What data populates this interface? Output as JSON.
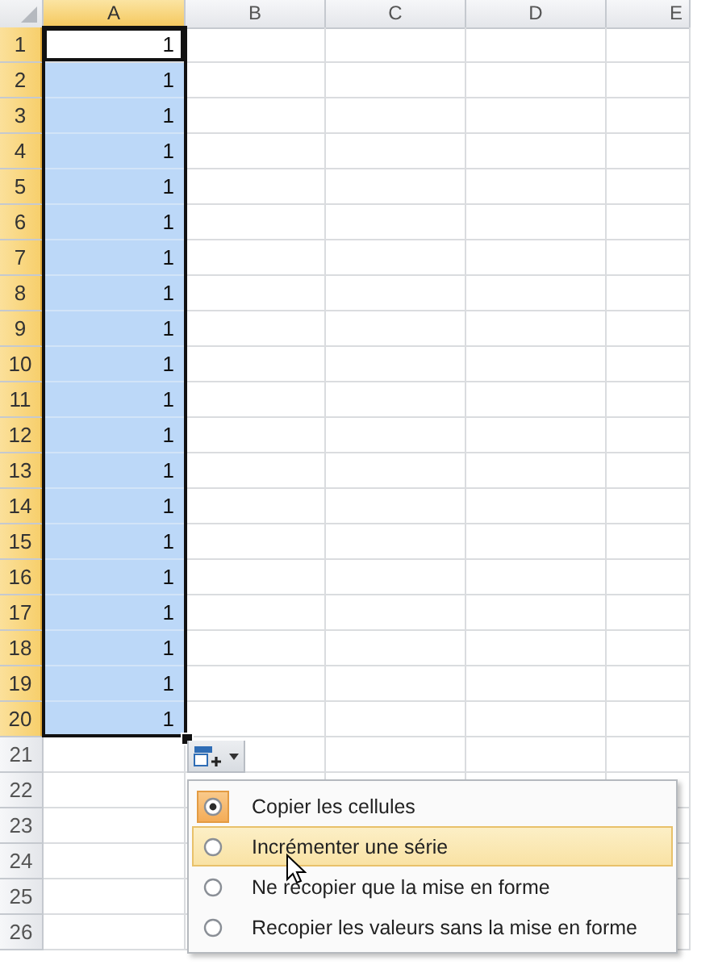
{
  "columns": [
    {
      "label": "A",
      "selected": true
    },
    {
      "label": "B",
      "selected": false
    },
    {
      "label": "C",
      "selected": false
    },
    {
      "label": "D",
      "selected": false
    },
    {
      "label": "E",
      "selected": false
    }
  ],
  "rows": [
    {
      "header": "1",
      "selected": true,
      "active": true,
      "cells": [
        "1"
      ]
    },
    {
      "header": "2",
      "selected": true,
      "active": false,
      "cells": [
        "1"
      ]
    },
    {
      "header": "3",
      "selected": true,
      "active": false,
      "cells": [
        "1"
      ]
    },
    {
      "header": "4",
      "selected": true,
      "active": false,
      "cells": [
        "1"
      ]
    },
    {
      "header": "5",
      "selected": true,
      "active": false,
      "cells": [
        "1"
      ]
    },
    {
      "header": "6",
      "selected": true,
      "active": false,
      "cells": [
        "1"
      ]
    },
    {
      "header": "7",
      "selected": true,
      "active": false,
      "cells": [
        "1"
      ]
    },
    {
      "header": "8",
      "selected": true,
      "active": false,
      "cells": [
        "1"
      ]
    },
    {
      "header": "9",
      "selected": true,
      "active": false,
      "cells": [
        "1"
      ]
    },
    {
      "header": "10",
      "selected": true,
      "active": false,
      "cells": [
        "1"
      ]
    },
    {
      "header": "11",
      "selected": true,
      "active": false,
      "cells": [
        "1"
      ]
    },
    {
      "header": "12",
      "selected": true,
      "active": false,
      "cells": [
        "1"
      ]
    },
    {
      "header": "13",
      "selected": true,
      "active": false,
      "cells": [
        "1"
      ]
    },
    {
      "header": "14",
      "selected": true,
      "active": false,
      "cells": [
        "1"
      ]
    },
    {
      "header": "15",
      "selected": true,
      "active": false,
      "cells": [
        "1"
      ]
    },
    {
      "header": "16",
      "selected": true,
      "active": false,
      "cells": [
        "1"
      ]
    },
    {
      "header": "17",
      "selected": true,
      "active": false,
      "cells": [
        "1"
      ]
    },
    {
      "header": "18",
      "selected": true,
      "active": false,
      "cells": [
        "1"
      ]
    },
    {
      "header": "19",
      "selected": true,
      "active": false,
      "cells": [
        "1"
      ]
    },
    {
      "header": "20",
      "selected": true,
      "active": false,
      "cells": [
        "1"
      ]
    },
    {
      "header": "21",
      "selected": false,
      "active": false,
      "cells": []
    },
    {
      "header": "22",
      "selected": false,
      "active": false,
      "cells": []
    },
    {
      "header": "23",
      "selected": false,
      "active": false,
      "cells": []
    },
    {
      "header": "24",
      "selected": false,
      "active": false,
      "cells": []
    },
    {
      "header": "25",
      "selected": false,
      "active": false,
      "cells": []
    },
    {
      "header": "26",
      "selected": false,
      "active": false,
      "cells": []
    }
  ],
  "autofill_menu": {
    "items": [
      {
        "label": "Copier les cellules",
        "checked": true,
        "hovered": false
      },
      {
        "label": "Incrémenter une série",
        "checked": false,
        "hovered": true
      },
      {
        "label": "Ne recopier que la mise en forme",
        "checked": false,
        "hovered": false
      },
      {
        "label": "Recopier les valeurs sans la mise en forme",
        "checked": false,
        "hovered": false
      }
    ]
  }
}
